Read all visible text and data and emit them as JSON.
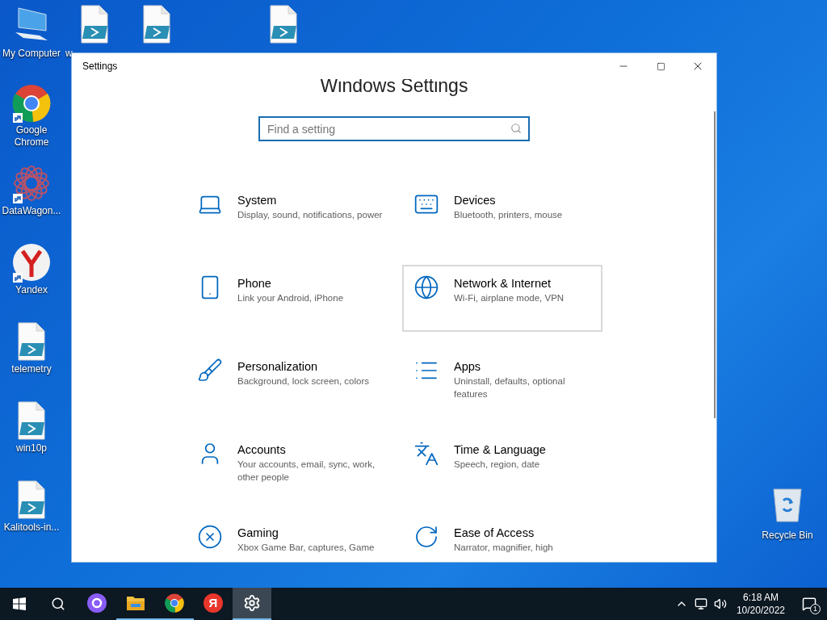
{
  "top_icons": [
    {
      "kind": "computer",
      "label": "My Computer"
    },
    {
      "kind": "script",
      "label": "w"
    },
    {
      "kind": "script"
    },
    {
      "kind": "script"
    }
  ],
  "left_icons": [
    {
      "kind": "chrome",
      "label": "Google Chrome",
      "shortcut": true
    },
    {
      "kind": "datawagon",
      "label": "DataWagon...",
      "shortcut": true
    },
    {
      "kind": "yandex",
      "label": "Yandex",
      "shortcut": true
    },
    {
      "kind": "script",
      "label": "telemetry",
      "shortcut": false
    },
    {
      "kind": "script",
      "label": "win10p",
      "shortcut": false
    },
    {
      "kind": "script",
      "label": "Kalitools-in...",
      "shortcut": false
    }
  ],
  "recycle_bin": {
    "label": "Recycle Bin"
  },
  "window": {
    "title": "Settings",
    "heading": "Windows Settings",
    "search": {
      "placeholder": "Find a setting"
    },
    "categories": [
      {
        "kind": "system",
        "title": "System",
        "description": "Display, sound, notifications, power",
        "hovered": false
      },
      {
        "kind": "devices",
        "title": "Devices",
        "description": "Bluetooth, printers, mouse",
        "hovered": false
      },
      {
        "kind": "phone",
        "title": "Phone",
        "description": "Link your Android, iPhone",
        "hovered": false
      },
      {
        "kind": "network",
        "title": "Network & Internet",
        "description": "Wi-Fi, airplane mode, VPN",
        "hovered": true
      },
      {
        "kind": "personalization",
        "title": "Personalization",
        "description": "Background, lock screen, colors",
        "hovered": false
      },
      {
        "kind": "apps",
        "title": "Apps",
        "description": "Uninstall, defaults, optional features",
        "hovered": false
      },
      {
        "kind": "accounts",
        "title": "Accounts",
        "description": "Your accounts, email, sync, work, other people",
        "hovered": false
      },
      {
        "kind": "time",
        "title": "Time & Language",
        "description": "Speech, region, date",
        "hovered": false
      },
      {
        "kind": "gaming",
        "title": "Gaming",
        "description": "Xbox Game Bar, captures, Game",
        "hovered": false
      },
      {
        "kind": "ease",
        "title": "Ease of Access",
        "description": "Narrator, magnifier, high",
        "hovered": false
      }
    ]
  },
  "taskbar": {
    "apps": [
      {
        "kind": "cortana",
        "running": false,
        "active": false
      },
      {
        "kind": "explorer",
        "running": true,
        "active": false
      },
      {
        "kind": "chrome",
        "running": true,
        "active": false
      },
      {
        "kind": "yandex",
        "label": "Я",
        "running": false,
        "active": false
      },
      {
        "kind": "settings",
        "running": true,
        "active": true
      }
    ],
    "time": "6:18 AM",
    "date": "10/20/2022",
    "notifications": "1"
  }
}
